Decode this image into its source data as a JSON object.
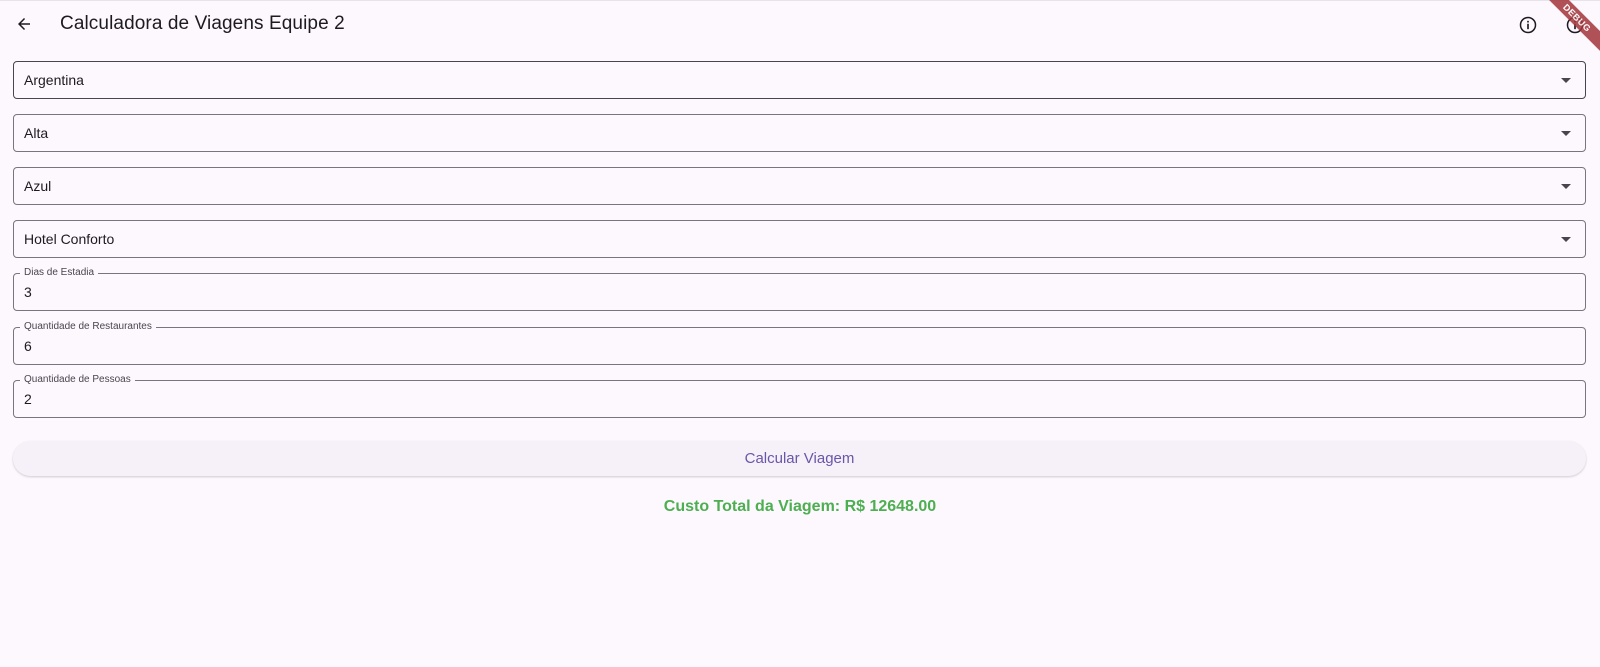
{
  "appbar": {
    "title": "Calculadora de Viagens Equipe 2",
    "back_icon": "arrow-back-icon",
    "actions": [
      "info-icon",
      "info-icon"
    ],
    "debug_banner": "DEBUG"
  },
  "form": {
    "destination": {
      "value": "Argentina"
    },
    "season": {
      "value": "Alta"
    },
    "airline": {
      "value": "Azul"
    },
    "hotel": {
      "value": "Hotel Conforto"
    },
    "days": {
      "label": "Dias de Estadia",
      "value": "3"
    },
    "restaurants": {
      "label": "Quantidade de Restaurantes",
      "value": "6"
    },
    "people": {
      "label": "Quantidade de Pessoas",
      "value": "2"
    }
  },
  "calculate_button": {
    "label": "Calcular Viagem"
  },
  "result": {
    "text": "Custo Total da Viagem: R$ 12648.00"
  },
  "colors": {
    "background": "#fdf7fe",
    "accent": "#6a56a8",
    "result": "#4caf50",
    "debug": "#a3353a"
  }
}
